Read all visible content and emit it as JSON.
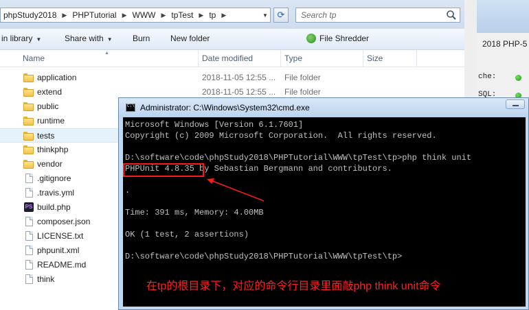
{
  "explorer": {
    "breadcrumbs": [
      "phpStudy2018",
      "PHPTutorial",
      "WWW",
      "tpTest",
      "tp"
    ],
    "search_placeholder": "Search tp",
    "toolbar": {
      "include_library": "in library",
      "share_with": "Share with",
      "burn": "Burn",
      "new_folder": "New folder",
      "file_shredder": "File Shredder"
    },
    "columns": {
      "name": "Name",
      "date": "Date modified",
      "type": "Type",
      "size": "Size"
    },
    "files": [
      {
        "name": "application",
        "icon": "folder-icon",
        "date": "2018-11-05 12:55 ...",
        "type": "File folder"
      },
      {
        "name": "extend",
        "icon": "folder-icon",
        "date": "2018-11-05 12:55 ...",
        "type": "File folder"
      },
      {
        "name": "public",
        "icon": "folder-icon",
        "date": "",
        "type": ""
      },
      {
        "name": "runtime",
        "icon": "folder-icon",
        "date": "",
        "type": ""
      },
      {
        "name": "tests",
        "icon": "folder-icon",
        "date": "",
        "type": ""
      },
      {
        "name": "thinkphp",
        "icon": "folder-icon",
        "date": "",
        "type": ""
      },
      {
        "name": "vendor",
        "icon": "folder-icon",
        "date": "",
        "type": ""
      },
      {
        "name": ".gitignore",
        "icon": "file-icon",
        "date": "",
        "type": ""
      },
      {
        "name": ".travis.yml",
        "icon": "file-icon",
        "date": "",
        "type": ""
      },
      {
        "name": "build.php",
        "icon": "php-file-icon",
        "date": "",
        "type": ""
      },
      {
        "name": "composer.json",
        "icon": "file-icon",
        "date": "",
        "type": ""
      },
      {
        "name": "LICENSE.txt",
        "icon": "file-icon",
        "date": "",
        "type": ""
      },
      {
        "name": "phpunit.xml",
        "icon": "file-icon",
        "date": "",
        "type": ""
      },
      {
        "name": "README.md",
        "icon": "file-icon",
        "date": "",
        "type": ""
      },
      {
        "name": "think",
        "icon": "file-icon",
        "date": "",
        "type": ""
      }
    ],
    "selected_file": "tests"
  },
  "background_window": {
    "tab_text": "2018   PHP-5",
    "line1": "che:",
    "line2": "SQL:"
  },
  "cmd": {
    "title": "Administrator: C:\\Windows\\System32\\cmd.exe",
    "lines": [
      "Microsoft Windows [Version 6.1.7601]",
      "Copyright (c) 2009 Microsoft Corporation.  All rights reserved.",
      "",
      "D:\\software\\code\\phpStudy2018\\PHPTutorial\\WWW\\tpTest\\tp>php think unit",
      "PHPUnit 4.8.35 by Sebastian Bergmann and contributors.",
      "",
      ".",
      "",
      "Time: 391 ms, Memory: 4.00MB",
      "",
      "OK (1 test, 2 assertions)",
      "",
      "D:\\software\\code\\phpStudy2018\\PHPTutorial\\WWW\\tpTest\\tp>"
    ],
    "annotation": "在tp的根目录下，对应的命令行目录里面敲php think unit命令",
    "annotation_color": "#ff2020"
  }
}
